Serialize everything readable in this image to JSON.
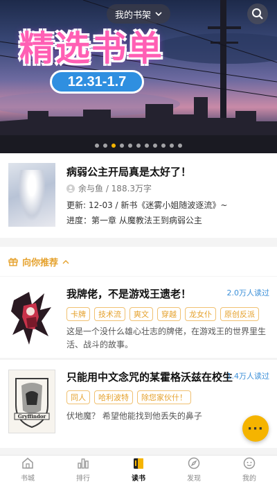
{
  "banner": {
    "shelf_label": "我的书架",
    "title": "精选书单",
    "date_range": "12.31-1.7",
    "dot_count": 11,
    "active_dot": 2
  },
  "reading": {
    "title": "病弱公主开局真是太好了！",
    "author_line": "余与鱼 / 188.3万字",
    "update_line": "更新: 12-03 / 新书《迷雾小姐随波逐流》~",
    "progress_line": "进度：第一章 从魔教法王到病弱公主"
  },
  "recommend": {
    "label": "向你推荐"
  },
  "books": [
    {
      "title": "我牌佬，不是游戏王遗老！",
      "readers": "2.0万人读过",
      "tags": [
        "卡牌",
        "技术流",
        "爽文",
        "穿越",
        "龙女仆",
        "原创反派"
      ],
      "desc": "这是一个没什么雄心壮志的牌佬，在游戏王的世界里生活、战斗的故事。"
    },
    {
      "title": "只能用中文念咒的某霍格沃兹在校生",
      "readers": "1.4万人读过",
      "tags": [
        "同人",
        "哈利波特",
        "除您家伙什！"
      ],
      "desc": "伏地魔？ 希望他能找到他丢失的鼻子",
      "cover_text": "Gryffindor"
    }
  ],
  "fab_label": "···",
  "tabs": [
    {
      "label": "书城",
      "icon": "home-icon"
    },
    {
      "label": "排行",
      "icon": "bar-chart-icon"
    },
    {
      "label": "读书",
      "icon": "book-icon",
      "active": true
    },
    {
      "label": "发现",
      "icon": "compass-icon"
    },
    {
      "label": "我的",
      "icon": "profile-icon"
    }
  ],
  "colors": {
    "accent": "#f5b400",
    "tag_text": "#e5a12c",
    "reader_count": "#3b8fd8"
  }
}
